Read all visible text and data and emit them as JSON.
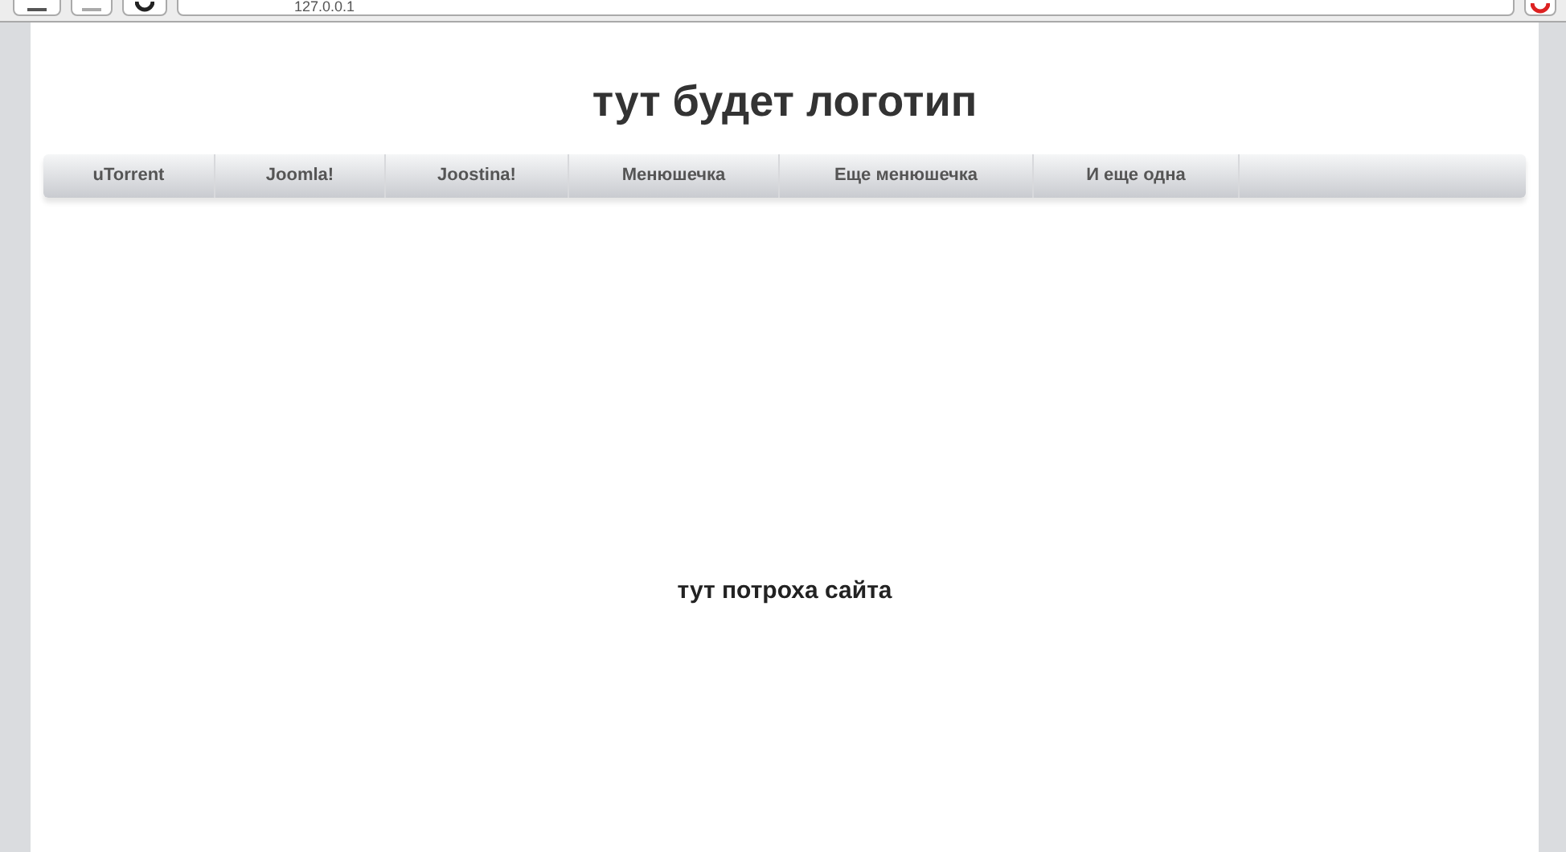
{
  "browser": {
    "address": "127.0.0.1"
  },
  "logo": "тут будет логотип",
  "menu": [
    {
      "label": "uTorrent"
    },
    {
      "label": "Joomla!"
    },
    {
      "label": "Joostina!"
    },
    {
      "label": "Менюшечка"
    },
    {
      "label": "Еще менюшечка"
    },
    {
      "label": "И еще одна"
    }
  ],
  "content": "тут потроха сайта"
}
